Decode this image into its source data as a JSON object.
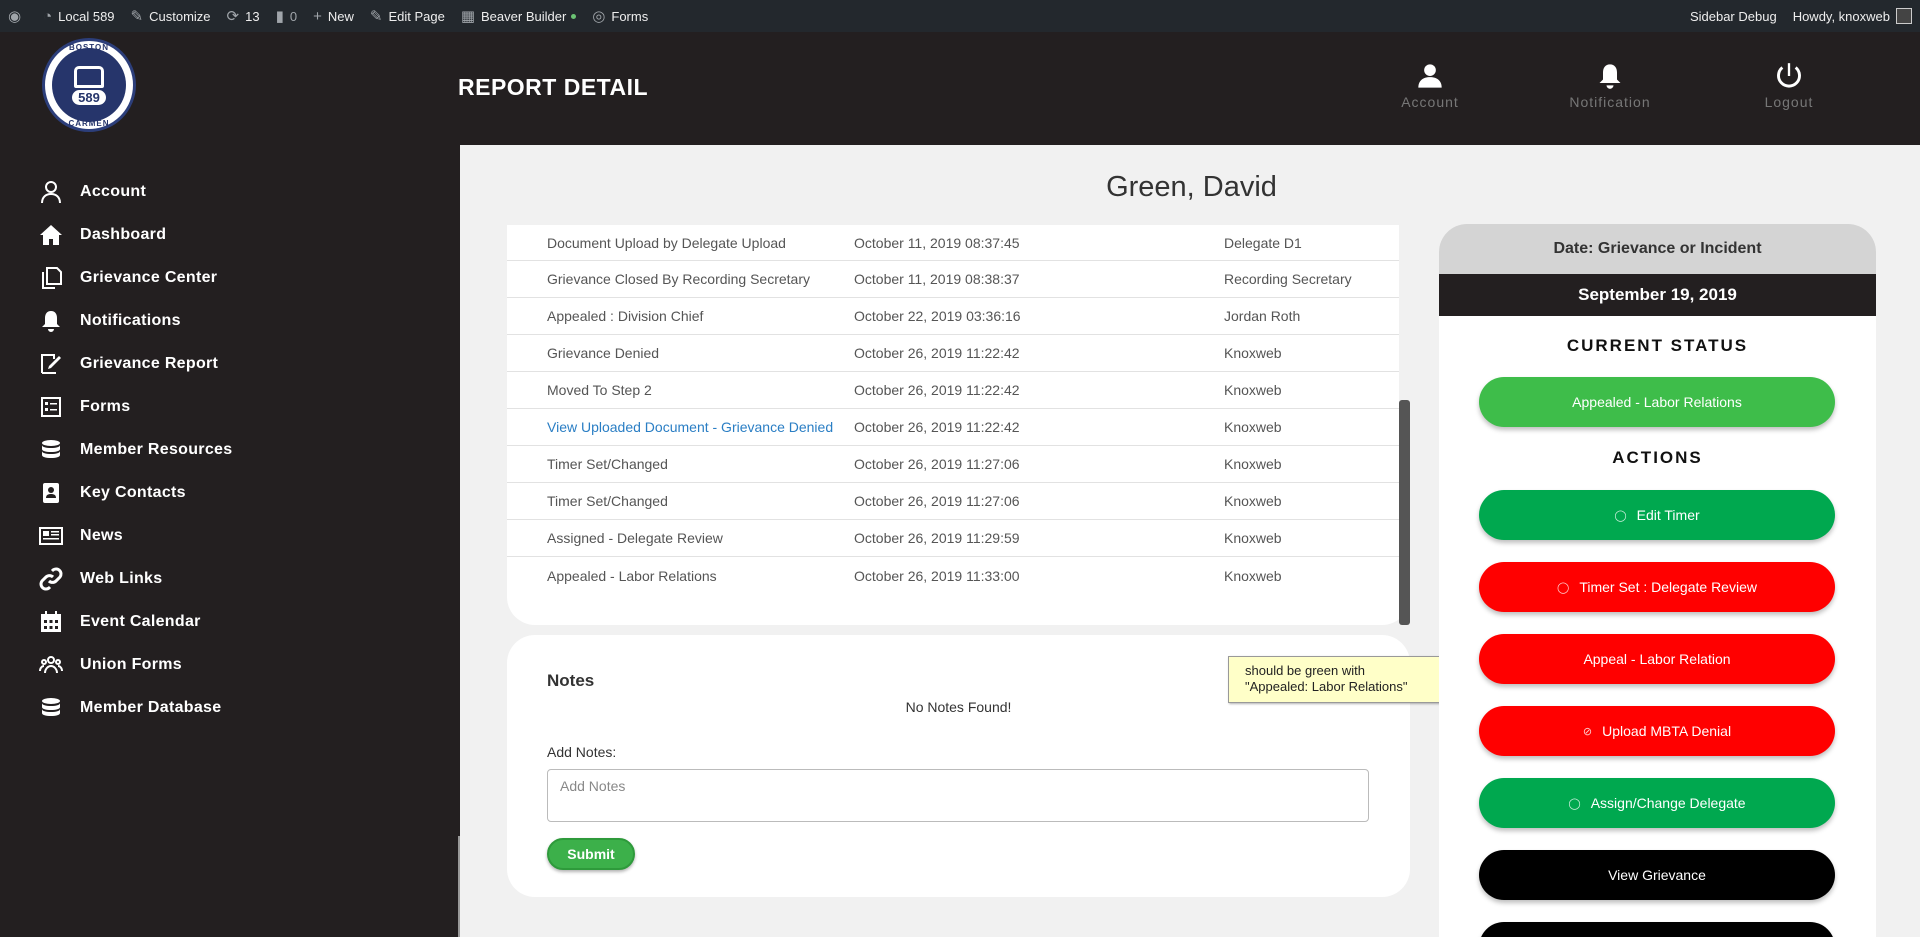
{
  "adminbar": {
    "site": "Local 589",
    "customize": "Customize",
    "updates": "13",
    "comments": "0",
    "new": "New",
    "edit_page": "Edit Page",
    "builder": "Beaver Builder",
    "forms": "Forms",
    "debug": "Sidebar Debug",
    "howdy": "Howdy, knoxweb"
  },
  "logo": {
    "top": "BOSTON",
    "number": "589",
    "bottom": "CARMEN"
  },
  "sidebar": {
    "items": [
      {
        "label": "Account",
        "icon": "user-icon"
      },
      {
        "label": "Dashboard",
        "icon": "home-icon"
      },
      {
        "label": "Grievance Center",
        "icon": "copy-icon"
      },
      {
        "label": "Notifications",
        "icon": "bell-icon"
      },
      {
        "label": "Grievance Report",
        "icon": "report-icon"
      },
      {
        "label": "Forms",
        "icon": "form-icon"
      },
      {
        "label": "Member Resources",
        "icon": "database-icon"
      },
      {
        "label": "Key Contacts",
        "icon": "contact-icon"
      },
      {
        "label": "News",
        "icon": "news-icon"
      },
      {
        "label": "Web Links",
        "icon": "link-icon"
      },
      {
        "label": "Event Calendar",
        "icon": "calendar-icon"
      },
      {
        "label": "Union Forms",
        "icon": "users-icon"
      },
      {
        "label": "Member Database",
        "icon": "database-icon"
      }
    ]
  },
  "header": {
    "title": "REPORT DETAIL",
    "account": "Account",
    "notification": "Notification",
    "logout": "Logout"
  },
  "member_name": "Green, David",
  "history": [
    {
      "event": "Document Upload by Delegate Upload",
      "date": "October 11, 2019 08:37:45",
      "by": "Delegate D1",
      "link": false
    },
    {
      "event": "Grievance Closed By Recording Secretary",
      "date": "October 11, 2019 08:38:37",
      "by": "Recording Secretary",
      "link": false
    },
    {
      "event": "Appealed : Division Chief",
      "date": "October 22, 2019 03:36:16",
      "by": "Jordan Roth",
      "link": false
    },
    {
      "event": "Grievance Denied",
      "date": "October 26, 2019 11:22:42",
      "by": "Knoxweb",
      "link": false
    },
    {
      "event": "Moved To Step 2",
      "date": "October 26, 2019 11:22:42",
      "by": "Knoxweb",
      "link": false
    },
    {
      "event": "View Uploaded Document - Grievance Denied",
      "date": "October 26, 2019 11:22:42",
      "by": "Knoxweb",
      "link": true
    },
    {
      "event": "Timer Set/Changed",
      "date": "October 26, 2019 11:27:06",
      "by": "Knoxweb",
      "link": false
    },
    {
      "event": "Timer Set/Changed",
      "date": "October 26, 2019 11:27:06",
      "by": "Knoxweb",
      "link": false
    },
    {
      "event": "Assigned - Delegate Review",
      "date": "October 26, 2019 11:29:59",
      "by": "Knoxweb",
      "link": false
    },
    {
      "event": "Appealed - Labor Relations",
      "date": "October 26, 2019 11:33:00",
      "by": "Knoxweb",
      "link": false
    }
  ],
  "notes": {
    "title": "Notes",
    "empty": "No Notes Found!",
    "add_label": "Add Notes:",
    "placeholder": "Add Notes",
    "submit": "Submit"
  },
  "callout": {
    "line1": "should be green with",
    "line2": "\"Appealed: Labor Relations\""
  },
  "status": {
    "date_label": "Date: Grievance or Incident",
    "date": "September 19, 2019",
    "current_heading": "CURRENT STATUS",
    "current": "Appealed - Labor Relations",
    "actions_heading": "ACTIONS",
    "actions": [
      {
        "label": "Edit Timer",
        "color": "#00a84f",
        "icon": "check-circle-icon"
      },
      {
        "label": "Timer Set : Delegate Review",
        "color": "#ff0000",
        "icon": "check-circle-icon"
      },
      {
        "label": "Appeal - Labor Relation",
        "color": "#ff0000",
        "icon": ""
      },
      {
        "label": "Upload MBTA Denial",
        "color": "#ff0000",
        "icon": "ban-icon"
      },
      {
        "label": "Assign/Change Delegate",
        "color": "#00a84f",
        "icon": "circle-icon"
      },
      {
        "label": "View Grievance",
        "color": "#000000",
        "icon": ""
      }
    ]
  }
}
